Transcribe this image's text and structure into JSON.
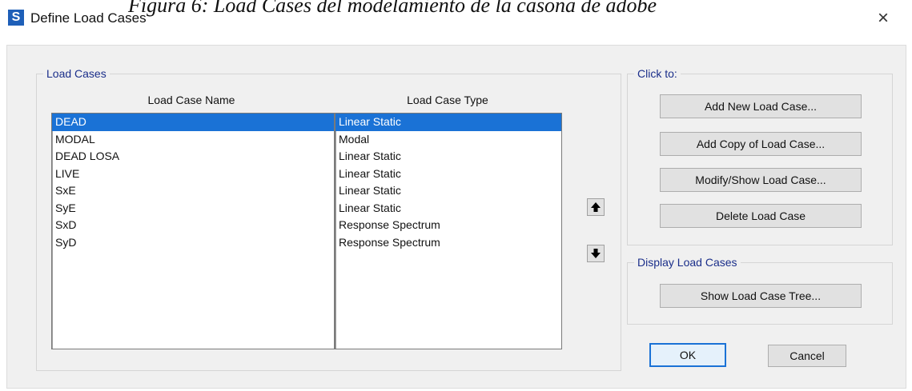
{
  "caption": "Figura 6: Load Cases del modelamiento de la casona de adobe",
  "window": {
    "app_icon": "S",
    "title": "Define Load Cases",
    "close_glyph": "×"
  },
  "load_cases_group": {
    "label": "Load Cases",
    "columns": [
      "Load Case Name",
      "Load Case Type"
    ],
    "rows": [
      {
        "name": "DEAD",
        "type": "Linear Static",
        "selected": true
      },
      {
        "name": "MODAL",
        "type": "Modal",
        "selected": false
      },
      {
        "name": "DEAD LOSA",
        "type": "Linear Static",
        "selected": false
      },
      {
        "name": "LIVE",
        "type": "Linear Static",
        "selected": false
      },
      {
        "name": "SxE",
        "type": "Linear Static",
        "selected": false
      },
      {
        "name": "SyE",
        "type": "Linear Static",
        "selected": false
      },
      {
        "name": "SxD",
        "type": "Response Spectrum",
        "selected": false
      },
      {
        "name": "SyD",
        "type": "Response Spectrum",
        "selected": false
      }
    ]
  },
  "order_buttons": {
    "up_icon": "arrow-up-icon",
    "down_icon": "arrow-down-icon"
  },
  "click_to_group": {
    "label": "Click to:",
    "add_new": "Add New Load Case...",
    "add_copy": "Add Copy of Load Case...",
    "modify_show": "Modify/Show Load Case...",
    "delete": "Delete Load Case"
  },
  "display_group": {
    "label": "Display Load Cases",
    "show_tree": "Show Load Case Tree..."
  },
  "footer": {
    "ok": "OK",
    "cancel": "Cancel"
  },
  "colors": {
    "selection": "#1a72d6",
    "group_label": "#1a2e8a",
    "dialog_bg": "#f0f0f0"
  }
}
